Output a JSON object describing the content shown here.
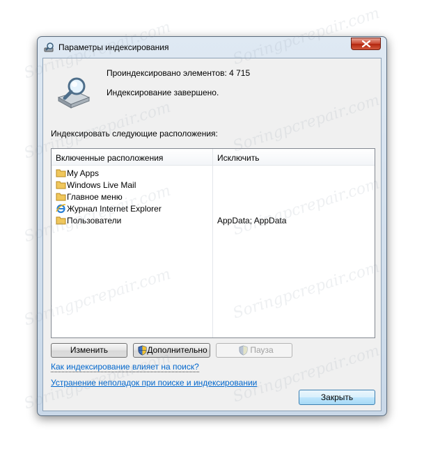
{
  "window": {
    "title": "Параметры индексирования",
    "title_icon": "search-magnifier-icon",
    "close_icon": "close-icon"
  },
  "summary": {
    "count_label": "Проиндексировано элементов: 4 715",
    "status": "Индексирование завершено.",
    "icon": "drive-magnifier-icon"
  },
  "locations_label": "Индексировать следующие расположения:",
  "table": {
    "headers": [
      "Включенные расположения",
      "Исключить"
    ],
    "rows": [
      {
        "name": "My Apps",
        "exclude": "",
        "icon": "folder-icon"
      },
      {
        "name": "Windows Live Mail",
        "exclude": "",
        "icon": "folder-icon"
      },
      {
        "name": "Главное меню",
        "exclude": "",
        "icon": "folder-icon"
      },
      {
        "name": "Журнал Internet Explorer",
        "exclude": "",
        "icon": "ie-icon"
      },
      {
        "name": "Пользователи",
        "exclude": "AppData; AppData",
        "icon": "folder-icon"
      }
    ]
  },
  "buttons": {
    "modify": "Изменить",
    "advanced": "Дополнительно",
    "pause": "Пауза",
    "close": "Закрыть"
  },
  "links": {
    "how_affects": "Как индексирование влияет на поиск?",
    "troubleshoot": "Устранение неполадок при поиске и индексировании"
  },
  "watermark": "Soringpcrepair.com",
  "colors": {
    "link": "#0066cc",
    "close_button": "#c9452e",
    "default_button_border": "#3c7fb1"
  }
}
